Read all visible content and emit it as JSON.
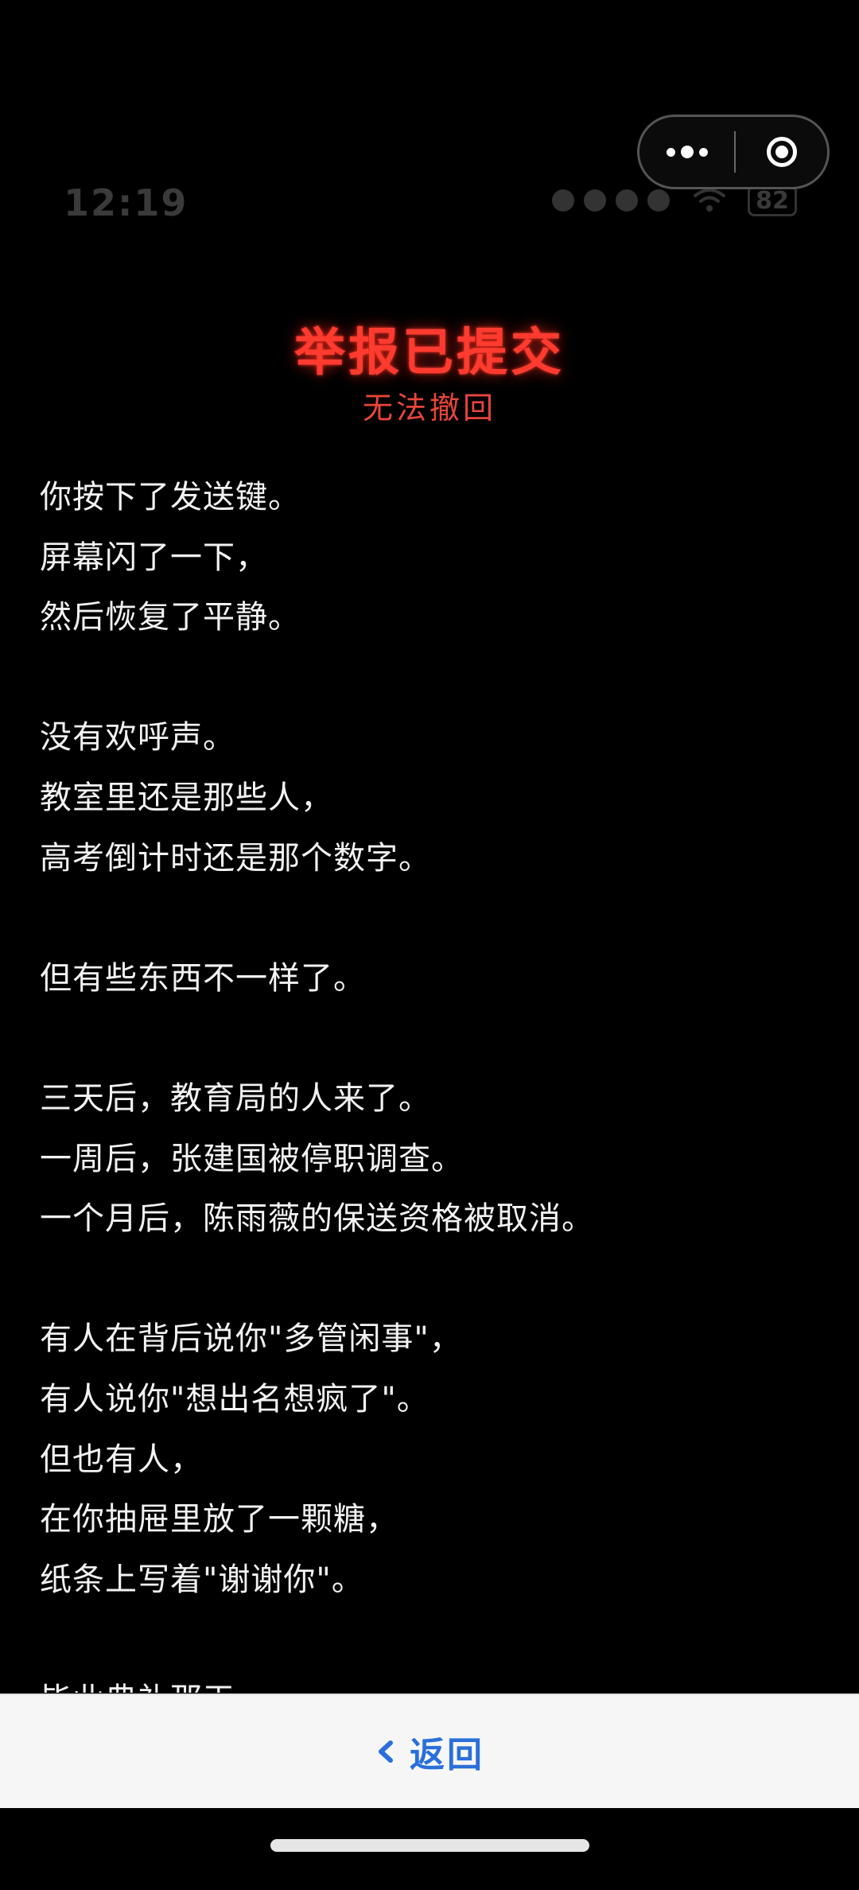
{
  "status_bar": {
    "time": "12:19",
    "battery": "82",
    "signal_bars": 4
  },
  "capsule": {
    "more_icon": "more-dots-icon",
    "close_icon": "target-ring-icon"
  },
  "header": {
    "title": "举报已提交",
    "subtitle": "无法撤回"
  },
  "story": {
    "lines": [
      "你按下了发送键。",
      "屏幕闪了一下，",
      "然后恢复了平静。",
      "",
      "没有欢呼声。",
      "教室里还是那些人，",
      "高考倒计时还是那个数字。",
      "",
      "但有些东西不一样了。",
      "",
      "三天后，教育局的人来了。",
      "一周后，张建国被停职调查。",
      "一个月后，陈雨薇的保送资格被取消。",
      "",
      "有人在背后说你\"多管闲事\"，",
      "有人说你\"想出名想疯了\"。",
      "但也有人，",
      "在你抽屉里放了一颗糖，",
      "纸条上写着\"谢谢你\"。",
      "",
      "毕业典礼那天"
    ]
  },
  "bottom_bar": {
    "back_label": "返回",
    "back_icon": "chevron-left-icon"
  },
  "colors": {
    "background": "#000000",
    "title_red": "#ff3b30",
    "subtitle_red": "#e8453c",
    "link_blue": "#2a6fdb",
    "bottom_bar_bg": "#f6f6f6"
  }
}
